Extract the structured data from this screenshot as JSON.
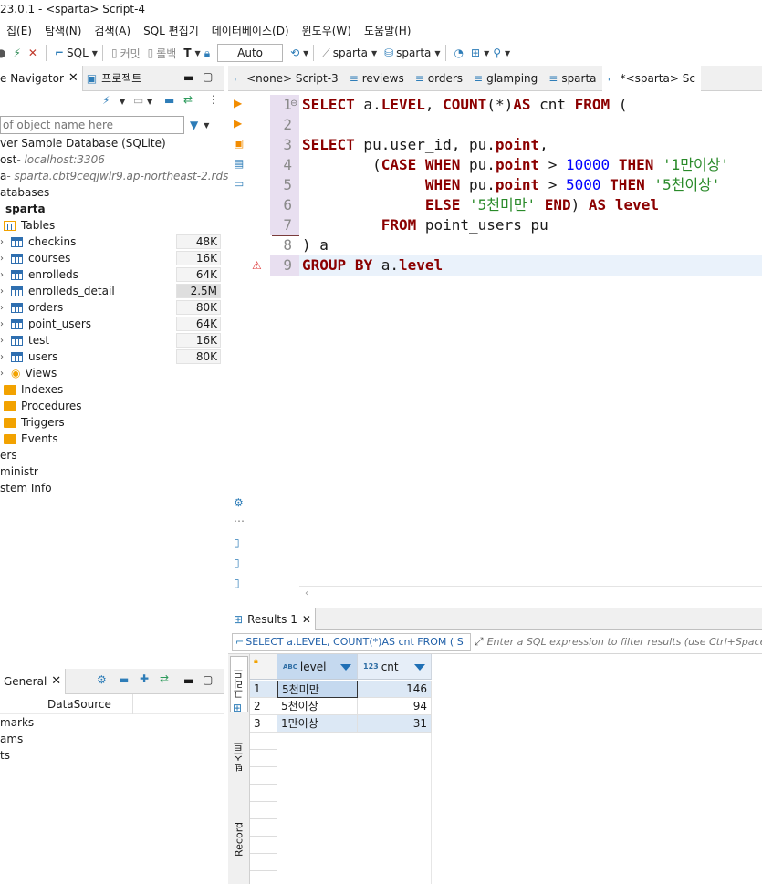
{
  "window": {
    "title": "23.0.1 - <sparta> Script-4"
  },
  "menu": [
    "집(E)",
    "탐색(N)",
    "검색(A)",
    "SQL 편집기",
    "데이터베이스(D)",
    "윈도우(W)",
    "도움말(H)"
  ],
  "toolbar": {
    "sql_label": "SQL",
    "commit_label": "커밋",
    "rollback_label": "롤백",
    "tx_mode": "Auto",
    "datasource": "sparta",
    "schema": "sparta"
  },
  "navigator": {
    "tab1": "e Navigator",
    "tab2": "프로젝트",
    "filter_placeholder": "of object name here",
    "items": [
      {
        "label": "ver Sample Database (SQLite)",
        "sub": ""
      },
      {
        "label": "ost",
        "sub": " - localhost:3306"
      },
      {
        "label": "a",
        "sub": " - sparta.cbt9ceqjwlr9.ap-northeast-2.rds.am"
      },
      {
        "label": "atabases",
        "sub": ""
      },
      {
        "label": "sparta",
        "sub": ""
      },
      {
        "label": "Tables",
        "sub": ""
      }
    ],
    "tables": [
      {
        "name": "checkins",
        "size": "48K"
      },
      {
        "name": "courses",
        "size": "16K"
      },
      {
        "name": "enrolleds",
        "size": "64K"
      },
      {
        "name": "enrolleds_detail",
        "size": "2.5M"
      },
      {
        "name": "orders",
        "size": "80K"
      },
      {
        "name": "point_users",
        "size": "64K"
      },
      {
        "name": "test",
        "size": "16K"
      },
      {
        "name": "users",
        "size": "80K"
      }
    ],
    "folders": [
      "Views",
      "Indexes",
      "Procedures",
      "Triggers",
      "Events"
    ],
    "others": [
      "ers",
      "ministr",
      "stem Info"
    ]
  },
  "general": {
    "tab": "General",
    "column_header": "DataSource",
    "rows": [
      "marks",
      "ams",
      "ts"
    ]
  },
  "editor": {
    "tabs": [
      "<none> Script-3",
      "reviews",
      "orders",
      "glamping",
      "sparta",
      "*<sparta> Sc"
    ],
    "line_numbers": [
      "1",
      "2",
      "3",
      "4",
      "5",
      "6",
      "7",
      "8",
      "9"
    ]
  },
  "results": {
    "tab": "Results 1",
    "query_preview": "SELECT a.LEVEL, COUNT(*)AS cnt FROM ( S",
    "filter_placeholder": "Enter a SQL expression to filter results (use Ctrl+Space)",
    "side_tabs": [
      "그리드",
      "텍스트",
      "Record"
    ],
    "columns": [
      {
        "type": "ABC",
        "name": "level"
      },
      {
        "type": "123",
        "name": "cnt"
      }
    ],
    "rows": [
      {
        "n": "1",
        "level": "5천미만",
        "cnt": "146"
      },
      {
        "n": "2",
        "level": "5천이상",
        "cnt": "94"
      },
      {
        "n": "3",
        "level": "1만이상",
        "cnt": "31"
      }
    ]
  },
  "colors": {
    "keyword": "#8b0000",
    "number": "#0000ff",
    "string": "#2a8a2a",
    "accent": "#2e7db8"
  }
}
